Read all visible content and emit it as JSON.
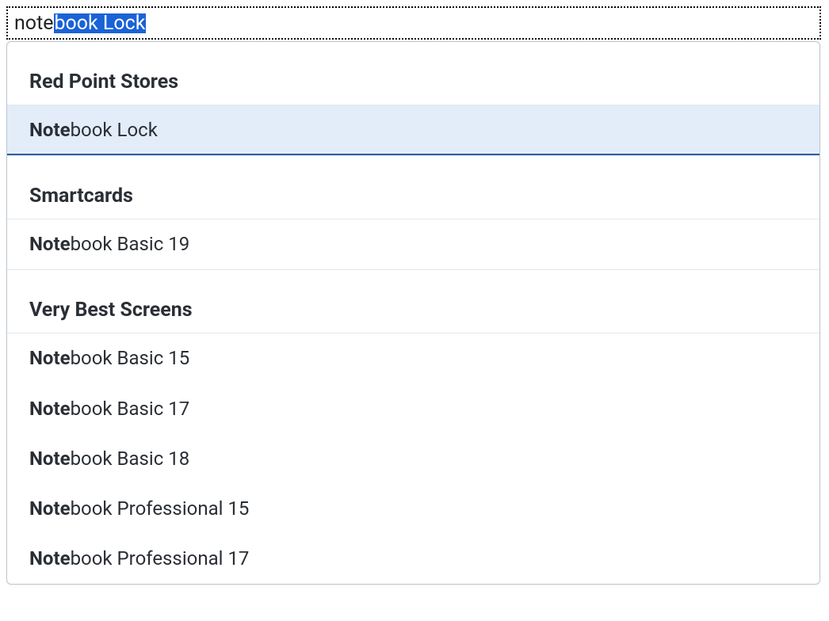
{
  "input": {
    "typed": "note",
    "selected": "book Lock"
  },
  "match": "Note",
  "groups": [
    {
      "header": "Red Point Stores",
      "items": [
        {
          "rest": "book Lock",
          "selected": true
        }
      ]
    },
    {
      "header": "Smartcards",
      "items": [
        {
          "rest": "book Basic 19",
          "selected": false
        }
      ]
    },
    {
      "header": "Very Best Screens",
      "items": [
        {
          "rest": "book Basic 15",
          "selected": false
        },
        {
          "rest": "book Basic 17",
          "selected": false
        },
        {
          "rest": "book Basic 18",
          "selected": false
        },
        {
          "rest": "book Professional 15",
          "selected": false
        },
        {
          "rest": "book Professional 17",
          "selected": false
        }
      ]
    }
  ]
}
